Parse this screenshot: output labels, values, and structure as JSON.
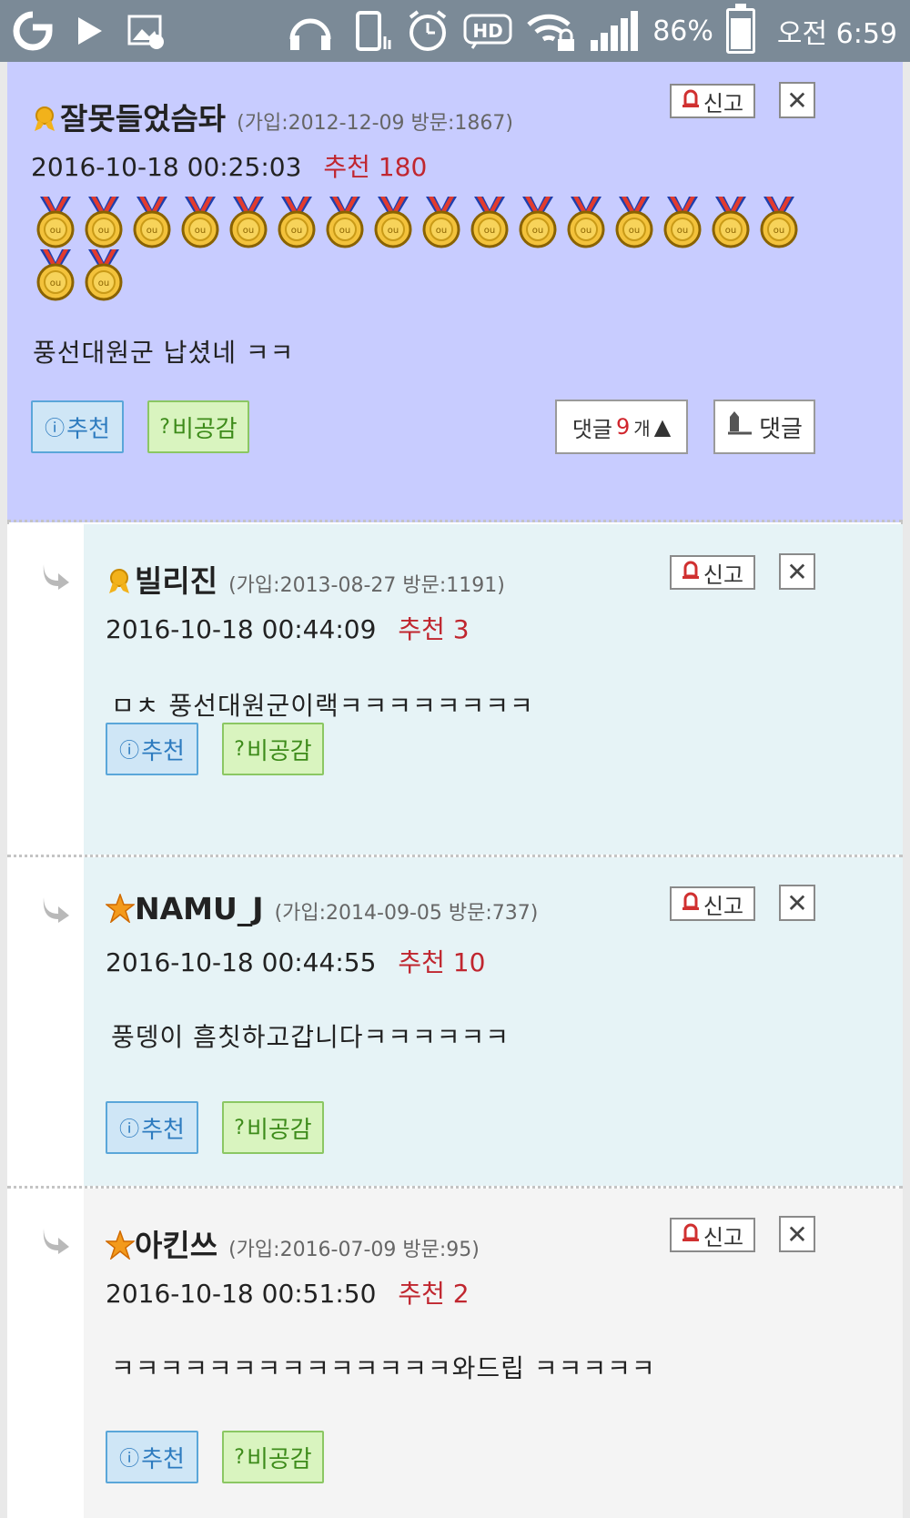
{
  "status_bar": {
    "battery": "86%",
    "time": "오전 6:59",
    "icons": [
      "g-logo-icon",
      "play-icon",
      "image-icon",
      "headphones-icon",
      "vibrate-icon",
      "alarm-icon",
      "hd-icon",
      "wifi-lock-icon",
      "signal-icon",
      "battery-icon"
    ]
  },
  "post": {
    "nickname": "잘못들었슴돠",
    "join_info": "(가입:2012-12-09 방문:1867)",
    "date": "2016-10-18 00:25:03",
    "recommend": "추천 180",
    "medal_count": 18,
    "content": "풍선대원군 납셨네 ㅋㅋ",
    "recommend_label": "추천",
    "dislike_label": "비공감",
    "comments_label": "댓글",
    "comments_count": "9",
    "comments_unit": "개",
    "reply_label": "댓글",
    "report_label": "신고"
  },
  "replies": [
    {
      "nickname": "빌리진",
      "join_info": "(가입:2013-08-27 방문:1191)",
      "date": "2016-10-18 00:44:09",
      "recommend": "추천 3",
      "content": "ㅁㅊ 풍선대원군이랙ㅋㅋㅋㅋㅋㅋㅋㅋ",
      "badge": "ribbon",
      "recommend_label": "추천",
      "dislike_label": "비공감",
      "report_label": "신고"
    },
    {
      "nickname": "NAMU_J",
      "join_info": "(가입:2014-09-05 방문:737)",
      "date": "2016-10-18 00:44:55",
      "recommend": "추천 10",
      "content": "풍뎅이 흠칫하고갑니다ㅋㅋㅋㅋㅋㅋ",
      "badge": "star",
      "recommend_label": "추천",
      "dislike_label": "비공감",
      "report_label": "신고"
    },
    {
      "nickname": "아킨쓰",
      "join_info": "(가입:2016-07-09 방문:95)",
      "date": "2016-10-18 00:51:50",
      "recommend": "추천 2",
      "content": "ㅋㅋㅋㅋㅋㅋㅋㅋㅋㅋㅋㅋㅋㅋ와드립 ㅋㅋㅋㅋㅋ",
      "badge": "star",
      "recommend_label": "추천",
      "dislike_label": "비공감",
      "report_label": "신고"
    }
  ],
  "colors": {
    "post_bg": "#c8ccff",
    "reply_bg_1": "#e6f3f6",
    "reply_bg_2": "#e6f3f6",
    "reply_bg_3": "#f4f4f4",
    "recommend_text": "#c0262f",
    "status_bar": "#7b8a97"
  }
}
